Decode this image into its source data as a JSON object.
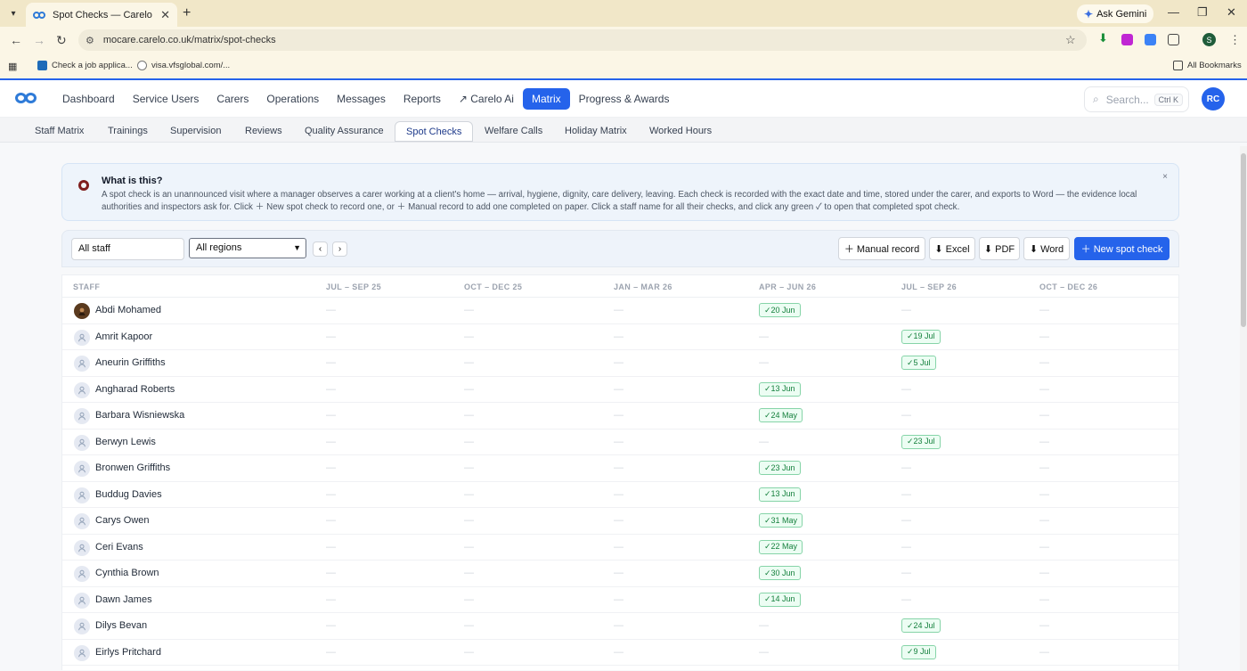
{
  "browser": {
    "tab_title": "Spot Checks — Carelo",
    "url": "mocare.carelo.co.uk/matrix/spot-checks",
    "gemini_label": "Ask Gemini",
    "profile_initial": "S",
    "bookmarks": [
      {
        "label": "Check a job applica..."
      },
      {
        "label": "visa.vfsglobal.com/..."
      }
    ],
    "all_bookmarks_label": "All Bookmarks"
  },
  "app": {
    "nav": [
      {
        "label": "Dashboard",
        "active": false
      },
      {
        "label": "Service Users",
        "active": false
      },
      {
        "label": "Carers",
        "active": false
      },
      {
        "label": "Operations",
        "active": false
      },
      {
        "label": "Messages",
        "active": false
      },
      {
        "label": "Reports",
        "active": false
      },
      {
        "label": "↗ Carelo Ai",
        "active": false
      },
      {
        "label": "Matrix",
        "active": true
      },
      {
        "label": "Progress & Awards",
        "active": false
      }
    ],
    "search_placeholder": "Search...",
    "search_shortcut": "Ctrl K",
    "user_initials": "RC"
  },
  "subtabs": [
    {
      "label": "Staff Matrix",
      "active": false
    },
    {
      "label": "Trainings",
      "active": false
    },
    {
      "label": "Supervision",
      "active": false
    },
    {
      "label": "Reviews",
      "active": false
    },
    {
      "label": "Quality Assurance",
      "active": false
    },
    {
      "label": "Spot Checks",
      "active": true
    },
    {
      "label": "Welfare Calls",
      "active": false
    },
    {
      "label": "Holiday Matrix",
      "active": false
    },
    {
      "label": "Worked Hours",
      "active": false
    }
  ],
  "info": {
    "title": "What is this?",
    "text": "A spot check is an unannounced visit where a manager observes a carer working at a client's home — arrival, hygiene, dignity, care delivery, leaving. Each check is recorded with the exact date and time, stored under the carer, and exports to Word — the evidence local authorities and inspectors ask for. Click ＋ New spot check to record one, or ＋ Manual record to add one completed on paper. Click a staff name for all their checks, and click any green ✓ to open that completed spot check.",
    "close": "×"
  },
  "toolbar": {
    "staff_filter": "All staff",
    "region_filter": "All regions",
    "prev": "‹",
    "next": "›",
    "manual_record": "＋ Manual record",
    "excel": "⬇ Excel",
    "pdf": "⬇ PDF",
    "word": "⬇ Word",
    "new_spot_check": "＋ New spot check"
  },
  "table": {
    "headers": [
      "STAFF",
      "JUL – SEP 25",
      "OCT – DEC 25",
      "JAN – MAR 26",
      "APR – JUN 26",
      "JUL – SEP 26",
      "OCT – DEC 26"
    ],
    "empty": "—",
    "rows": [
      {
        "name": "Abdi Mohamed",
        "photo": true,
        "cells": [
          "",
          "",
          "",
          "✓20 Jun",
          "",
          ""
        ]
      },
      {
        "name": "Amrit Kapoor",
        "photo": false,
        "cells": [
          "",
          "",
          "",
          "",
          "✓19 Jul",
          ""
        ]
      },
      {
        "name": "Aneurin Griffiths",
        "photo": false,
        "cells": [
          "",
          "",
          "",
          "",
          "✓5 Jul",
          ""
        ]
      },
      {
        "name": "Angharad Roberts",
        "photo": false,
        "cells": [
          "",
          "",
          "",
          "✓13 Jun",
          "",
          ""
        ]
      },
      {
        "name": "Barbara Wisniewska",
        "photo": false,
        "cells": [
          "",
          "",
          "",
          "✓24 May",
          "",
          ""
        ]
      },
      {
        "name": "Berwyn Lewis",
        "photo": false,
        "cells": [
          "",
          "",
          "",
          "",
          "✓23 Jul",
          ""
        ]
      },
      {
        "name": "Bronwen Griffiths",
        "photo": false,
        "cells": [
          "",
          "",
          "",
          "✓23 Jun",
          "",
          ""
        ]
      },
      {
        "name": "Buddug Davies",
        "photo": false,
        "cells": [
          "",
          "",
          "",
          "✓13 Jun",
          "",
          ""
        ]
      },
      {
        "name": "Carys Owen",
        "photo": false,
        "cells": [
          "",
          "",
          "",
          "✓31 May",
          "",
          ""
        ]
      },
      {
        "name": "Ceri Evans",
        "photo": false,
        "cells": [
          "",
          "",
          "",
          "✓22 May",
          "",
          ""
        ]
      },
      {
        "name": "Cynthia Brown",
        "photo": false,
        "cells": [
          "",
          "",
          "",
          "✓30 Jun",
          "",
          ""
        ]
      },
      {
        "name": "Dawn James",
        "photo": false,
        "cells": [
          "",
          "",
          "",
          "✓14 Jun",
          "",
          ""
        ]
      },
      {
        "name": "Dilys Bevan",
        "photo": false,
        "cells": [
          "",
          "",
          "",
          "",
          "✓24 Jul",
          ""
        ]
      },
      {
        "name": "Eirlys Pritchard",
        "photo": false,
        "cells": [
          "",
          "",
          "",
          "",
          "✓9 Jul",
          ""
        ]
      }
    ]
  }
}
